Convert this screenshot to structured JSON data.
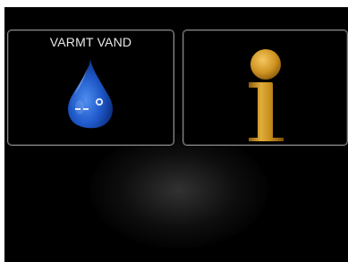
{
  "tiles": {
    "hot_water": {
      "title": "VARMT VAND",
      "icon": "water-drop-icon"
    },
    "info": {
      "icon": "info-icon"
    }
  },
  "colors": {
    "background": "#000000",
    "tile_border": "#8a8a8a",
    "title_text": "#e8e8e8",
    "drop_blue": "#1e58c8",
    "info_gold": "#c8901e"
  }
}
